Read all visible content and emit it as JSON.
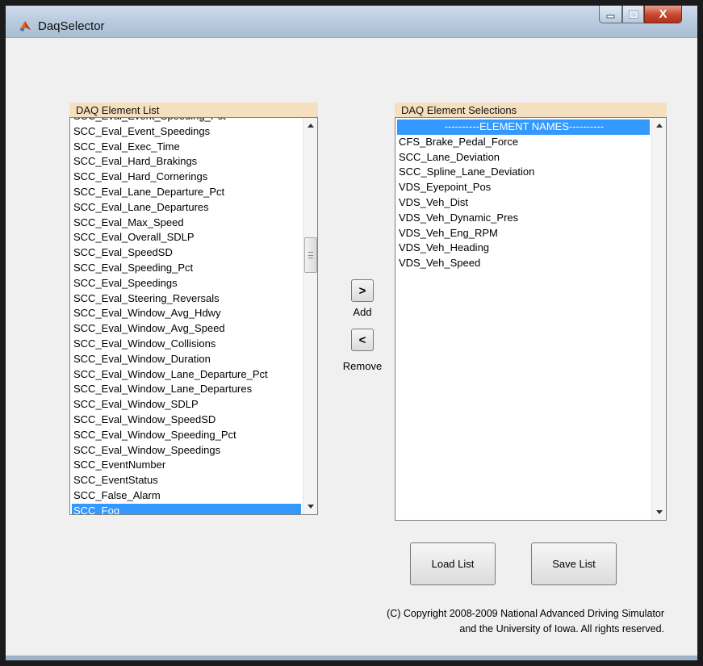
{
  "window": {
    "title": "DaqSelector",
    "close_glyph": "X"
  },
  "left_panel": {
    "title": "DAQ Element List",
    "items": [
      "SCC_Eval_Event_Speeding_Pct",
      "SCC_Eval_Event_Speedings",
      "SCC_Eval_Exec_Time",
      "SCC_Eval_Hard_Brakings",
      "SCC_Eval_Hard_Cornerings",
      "SCC_Eval_Lane_Departure_Pct",
      "SCC_Eval_Lane_Departures",
      "SCC_Eval_Max_Speed",
      "SCC_Eval_Overall_SDLP",
      "SCC_Eval_SpeedSD",
      "SCC_Eval_Speeding_Pct",
      "SCC_Eval_Speedings",
      "SCC_Eval_Steering_Reversals",
      "SCC_Eval_Window_Avg_Hdwy",
      "SCC_Eval_Window_Avg_Speed",
      "SCC_Eval_Window_Collisions",
      "SCC_Eval_Window_Duration",
      "SCC_Eval_Window_Lane_Departure_Pct",
      "SCC_Eval_Window_Lane_Departures",
      "SCC_Eval_Window_SDLP",
      "SCC_Eval_Window_SpeedSD",
      "SCC_Eval_Window_Speeding_Pct",
      "SCC_Eval_Window_Speedings",
      "SCC_EventNumber",
      "SCC_EventStatus",
      "SCC_False_Alarm",
      "SCC_Fog"
    ],
    "selected": "SCC_Fog"
  },
  "right_panel": {
    "title": "DAQ Element Selections",
    "items": [
      "----------ELEMENT NAMES----------",
      "CFS_Brake_Pedal_Force",
      "SCC_Lane_Deviation",
      "SCC_Spline_Lane_Deviation",
      "VDS_Eyepoint_Pos",
      "VDS_Veh_Dist",
      "VDS_Veh_Dynamic_Pres",
      "VDS_Veh_Eng_RPM",
      "VDS_Veh_Heading",
      "VDS_Veh_Speed"
    ],
    "selected": "----------ELEMENT NAMES----------"
  },
  "buttons": {
    "add_glyph": ">",
    "add_label": "Add",
    "remove_glyph": "<",
    "remove_label": "Remove",
    "load_list": "Load List",
    "save_list": "Save List"
  },
  "footer": {
    "copyright_line1": "(C) Copyright 2008-2009 National Advanced Driving Simulator",
    "copyright_line2": "and the University of Iowa.  All rights reserved."
  },
  "icons": {
    "app_icon": "matlab-icon",
    "minimize": "minimize-icon",
    "maximize": "maximize-icon",
    "close": "close-icon"
  },
  "colors": {
    "panel_title_bg": "#f6dfbf",
    "selection": "#3399ff",
    "window_bg": "#f0f0f0"
  }
}
